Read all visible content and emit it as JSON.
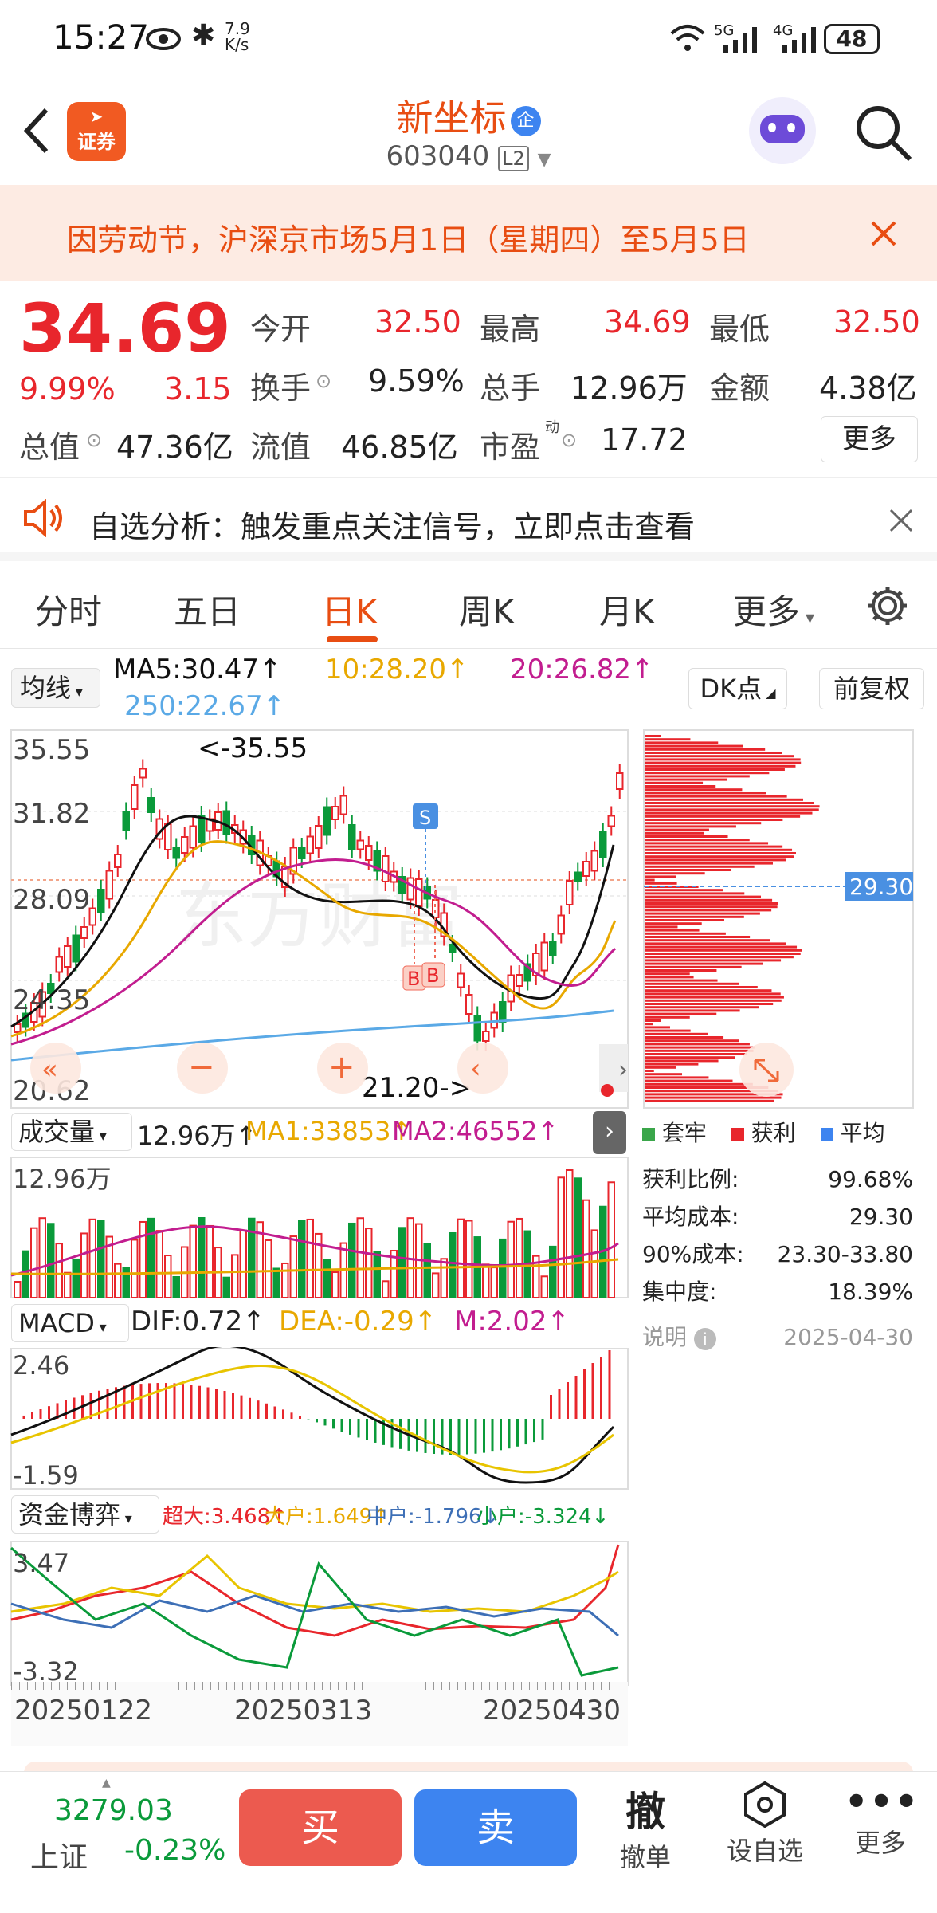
{
  "status": {
    "time": "15:27",
    "net_speed": "7.9",
    "net_unit": "K/s",
    "signal1": "5G",
    "signal2": "4G",
    "battery": "48"
  },
  "header": {
    "brand_badge": "证券",
    "title": "新坐标",
    "title_badge": "企",
    "code": "603040",
    "level": "L2"
  },
  "notice": {
    "text": "因劳动节，沪深京市场5月1日（星期四）至5月5日"
  },
  "quote": {
    "price": "34.69",
    "change_pct": "9.99%",
    "change": "3.15",
    "open_label": "今开",
    "open": "32.50",
    "high_label": "最高",
    "high": "34.69",
    "low_label": "最低",
    "low": "32.50",
    "turnover_label": "换手",
    "turnover": "9.59%",
    "volume_label": "总手",
    "volume": "12.96万",
    "amount_label": "金额",
    "amount": "4.38亿",
    "mcap_label": "总值",
    "mcap": "47.36亿",
    "float_label": "流值",
    "float": "46.85亿",
    "pe_label": "市盈",
    "pe_sup": "动",
    "pe": "17.72",
    "more": "更多"
  },
  "analysis": {
    "text": "自选分析：触发重点关注信号，立即点击查看"
  },
  "tabs": [
    "分时",
    "五日",
    "日K",
    "周K",
    "月K",
    "更多"
  ],
  "active_tab": 2,
  "ma": {
    "selector": "均线",
    "ma5": "MA5:30.47↑",
    "ma10": "10:28.20↑",
    "ma20": "20:26.82↑",
    "ma250": "250:22.67↑",
    "dk": "DK点",
    "adjust": "前复权"
  },
  "kline": {
    "y_labels": [
      "35.55",
      "31.82",
      "28.09",
      "24.35",
      "20.62"
    ],
    "high_note": "<-35.55",
    "low_note": "21.20->",
    "signal_s": "S",
    "signal_b1": "B",
    "signal_b2": "B",
    "watermark": "东方财富"
  },
  "chip": {
    "price_tag": "29.30",
    "legend": [
      "套牢",
      "获利",
      "平均"
    ],
    "rows": [
      {
        "k": "获利比例:",
        "v": "99.68%"
      },
      {
        "k": "平均成本:",
        "v": "29.30"
      },
      {
        "k": "90%成本:",
        "v": "23.30-33.80"
      },
      {
        "k": "集中度:",
        "v": "18.39%"
      }
    ],
    "note": "说明",
    "date": "2025-04-30"
  },
  "volume": {
    "selector": "成交量",
    "total": "12.96万↑",
    "ma1": "MA1:33853↑",
    "ma2": "MA2:46552↑",
    "y_label": "12.96万"
  },
  "macd": {
    "selector": "MACD",
    "dif": "DIF:0.72↑",
    "dea": "DEA:-0.29↑",
    "m": "M:2.02↑",
    "y_top": "2.46",
    "y_bottom": "-1.59"
  },
  "fund": {
    "selector": "资金博弈",
    "super": "超大:3.468↑",
    "big": "大户:1.649↑",
    "mid": "中户:-1.796↓",
    "small": "小户:-3.324↓",
    "y_top": "3.47",
    "y_bottom": "-3.32"
  },
  "dates": [
    "20250122",
    "20250313",
    "20250430"
  ],
  "bottom": {
    "index_value": "3279.03",
    "index_name": "上证",
    "index_change": "-0.23%",
    "buy": "买",
    "sell": "卖",
    "cancel_icon": "撤",
    "cancel": "撤单",
    "watch": "设自选",
    "more": "更多"
  },
  "colors": {
    "up": "#e8262c",
    "down": "#0a9a3a",
    "accent": "#e84d12",
    "ma5": "#111111",
    "ma10": "#e8a800",
    "ma20": "#c21d8f",
    "ma250": "#5aa9e6",
    "sell_btn": "#3d84f0"
  }
}
